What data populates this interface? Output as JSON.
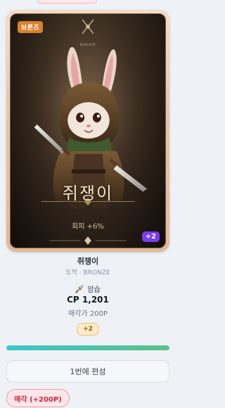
{
  "card": {
    "rarity_badge": "브론즈",
    "emblem_text": "ROGUE",
    "name": "쥐쟁이",
    "skill_line": "회피 +6%",
    "plus_badge": "+2"
  },
  "info": {
    "title": "쥐쟁이",
    "subtitle": "도적 · BRONZE",
    "skill_icon": "dagger-icon",
    "skill_name": "암습",
    "cp": "CP 1,201",
    "sell_price": "매각가 200P",
    "level_chip": "+2"
  },
  "progress": {
    "fill_fraction": 1.0
  },
  "actions": {
    "deploy_label": "1번에 편성",
    "sell_label": "매각 (+200P)"
  },
  "colors": {
    "rarity_bronze": "#d9822b",
    "plus_badge": "#7c3aed",
    "sell_accent": "#c8283f",
    "progress_start": "#3cc7c9",
    "progress_end": "#5fbf8a"
  }
}
